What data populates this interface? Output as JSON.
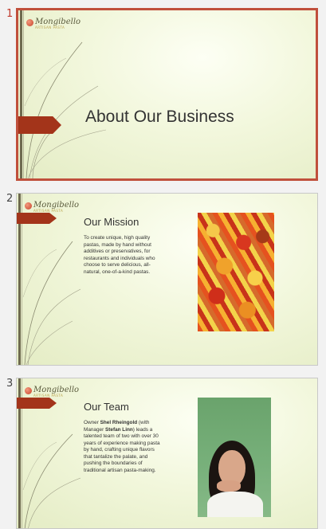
{
  "slides": [
    {
      "number": "1",
      "title": "About Our Business",
      "logo": {
        "name": "Mongibello",
        "tagline": "ARTISAN PASTA"
      }
    },
    {
      "number": "2",
      "title": "Our Mission",
      "body": "To create unique, high quality pastas, made by hand without additives or preservatives, for restaurants and individuals who choose to serve delicious, all-natural, one-of-a-kind pastas.",
      "logo": {
        "name": "Mongibello",
        "tagline": "ARTISAN PASTA"
      },
      "image": "pasta-photo"
    },
    {
      "number": "3",
      "title": "Our Team",
      "body": {
        "owner_prefix": "Owner ",
        "owner_name": "Shel Rheingold",
        "manager_prefix": " (with Manager ",
        "manager_name": "Stefan Linn",
        "rest": ") leads a talented team of two with over 30 years of experience making pasta by hand, crafting unique flavors that tantalize the palate, and pushing the boundaries of traditional artisan pasta-making."
      },
      "logo": {
        "name": "Mongibello",
        "tagline": "ARTISAN PASTA"
      },
      "image": "person-photo"
    }
  ],
  "colors": {
    "accent": "#a3341a",
    "selection": "#c0503c"
  }
}
